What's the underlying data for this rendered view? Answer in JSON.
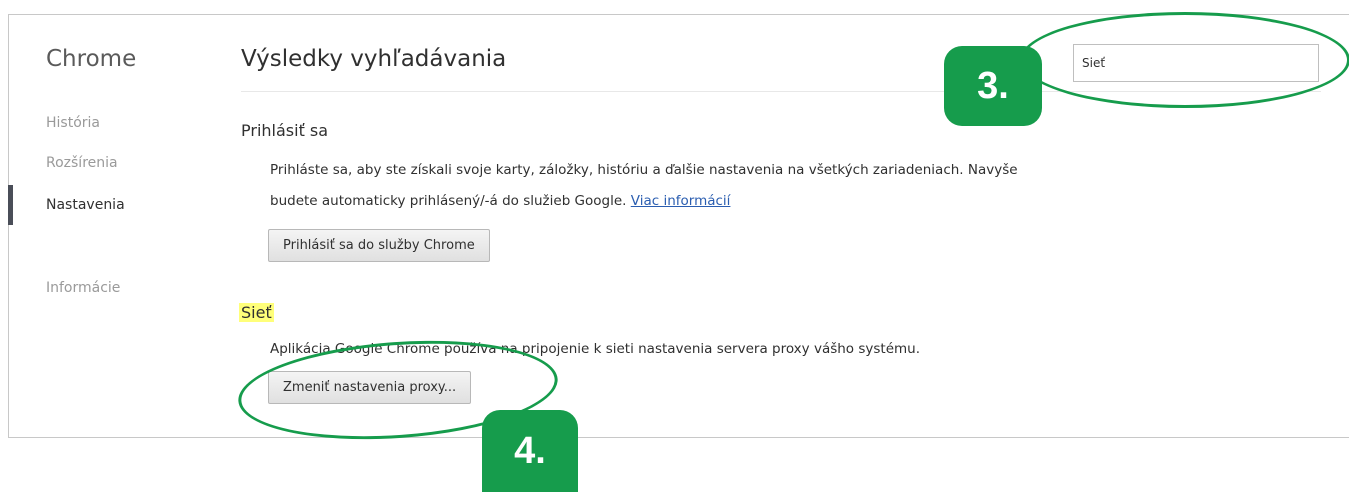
{
  "sidebar": {
    "title": "Chrome",
    "items": [
      {
        "label": "História"
      },
      {
        "label": "Rozšírenia"
      },
      {
        "label": "Nastavenia"
      },
      {
        "label": "Informácie"
      }
    ],
    "active_item": "Nastavenia"
  },
  "main": {
    "title": "Výsledky vyhľadávania",
    "search": {
      "value": "Sieť"
    },
    "sign_in": {
      "title": "Prihlásiť sa",
      "line1": "Prihláste sa, aby ste získali svoje karty, záložky, históriu a ďalšie nastavenia na všetkých zariadeniach. Navyše",
      "line2": "budete automaticky prihlásený/-á do služieb Google.",
      "link": "Viac informácií",
      "button": "Prihlásiť sa do služby Chrome"
    },
    "network": {
      "title": "Sieť",
      "description": "Aplikácia Google Chrome používa na pripojenie k sieti nastavenia servera proxy vášho systému.",
      "button": "Zmeniť nastavenia proxy..."
    }
  },
  "annotations": {
    "step3": "3.",
    "step4": "4.",
    "color": "#169c4c",
    "highlight_color": "#ffff7a"
  }
}
